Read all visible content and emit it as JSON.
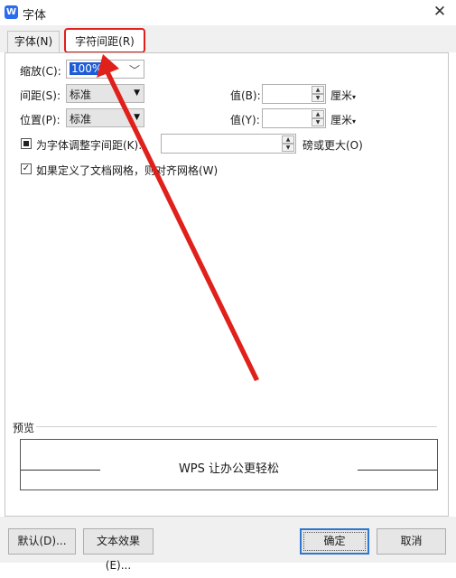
{
  "window": {
    "title": "字体",
    "app_icon_letter": "W"
  },
  "tabs": [
    {
      "label": "字体(N)"
    },
    {
      "label": "字符间距(R)"
    }
  ],
  "scale": {
    "label": "缩放(C):",
    "value": "100%"
  },
  "spacing": {
    "label": "间距(S):",
    "value": "标准",
    "value_label": "值(B):",
    "value_field": "",
    "unit": "厘米"
  },
  "position": {
    "label": "位置(P):",
    "value": "标准",
    "value_label": "值(Y):",
    "value_field": "",
    "unit": "厘米"
  },
  "kerning": {
    "label": "为字体调整字间距(K):",
    "value": "",
    "suffix": "磅或更大(O)",
    "checked": "filled"
  },
  "grid": {
    "label": "如果定义了文档网格，则对齐网格(W)",
    "checked": true
  },
  "preview": {
    "label": "预览",
    "text": "WPS 让办公更轻松"
  },
  "buttons": {
    "default": "默认(D)...",
    "text_effects": "文本效果(E)...",
    "ok": "确定",
    "cancel": "取消"
  },
  "colors": {
    "annotation": "#e0201b",
    "selection": "#1e5cd6",
    "ok_border": "#2e77d0",
    "app_icon": "#2b6df0"
  }
}
